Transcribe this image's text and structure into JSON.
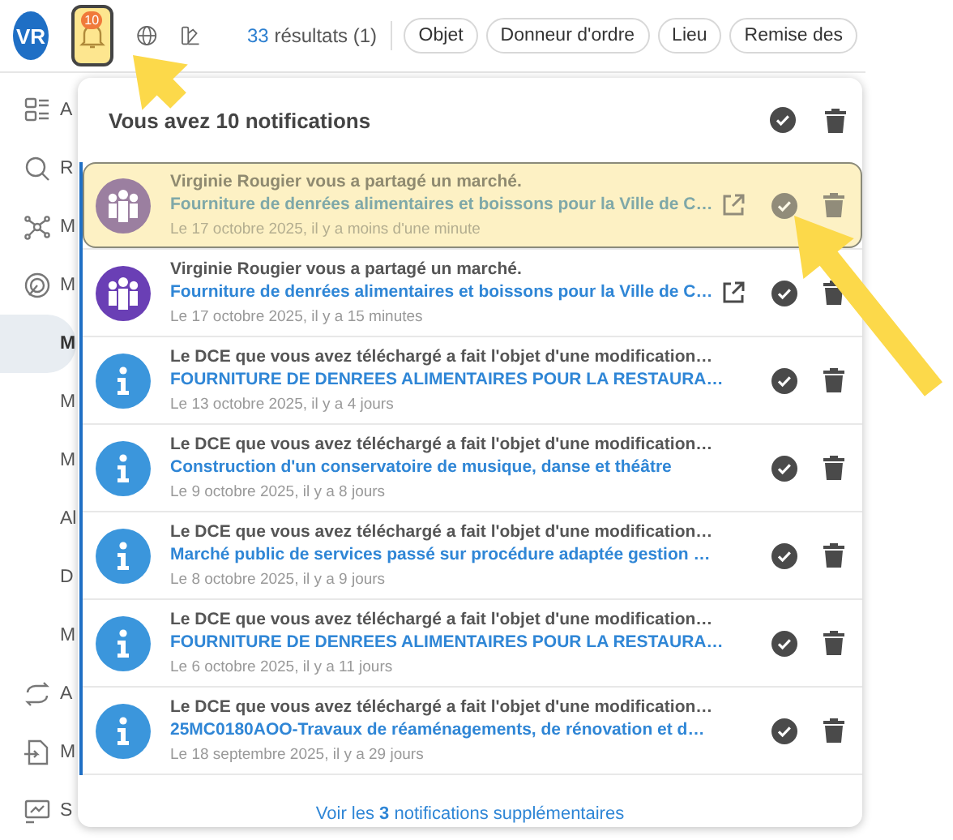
{
  "topbar": {
    "avatar": "VR",
    "bell": {
      "badge": "10",
      "selected": true
    },
    "results_count": "33",
    "results_label": "résultats (1)",
    "filters": [
      "Objet",
      "Donneur d'ordre",
      "Lieu",
      "Remise des"
    ]
  },
  "sidebar": {
    "items": [
      {
        "label": "A",
        "kind": "main",
        "selected": false
      },
      {
        "label": "R",
        "kind": "main",
        "selected": false
      },
      {
        "label": "M",
        "kind": "main",
        "selected": false
      },
      {
        "label": "M",
        "kind": "main",
        "selected": false
      },
      {
        "label": "M",
        "kind": "sub",
        "selected": true
      },
      {
        "label": "M",
        "kind": "sub",
        "selected": false
      },
      {
        "label": "M",
        "kind": "sub",
        "selected": false
      },
      {
        "label": "Al",
        "kind": "sub",
        "selected": false
      },
      {
        "label": "D",
        "kind": "sub",
        "selected": false
      },
      {
        "label": "M",
        "kind": "sub",
        "selected": false
      },
      {
        "label": "A",
        "kind": "main",
        "selected": false
      },
      {
        "label": "M",
        "kind": "main",
        "selected": false
      },
      {
        "label": "S",
        "kind": "main",
        "selected": false
      }
    ]
  },
  "notifications": {
    "title": "Vous avez **10** notifications",
    "items": [
      {
        "kind": "share",
        "highlighted": true,
        "title": "Virginie Rougier vous a partagé un marché.",
        "link": "Fourniture de denrées alimentaires et boissons pour la Ville de C…",
        "date": "Le 17 octobre 2025, il y a moins d'une minute"
      },
      {
        "kind": "share",
        "highlighted": false,
        "title": "Virginie Rougier vous a partagé un marché.",
        "link": "Fourniture de denrées alimentaires et boissons pour la Ville de C…",
        "date": "Le 17 octobre 2025, il y a 15 minutes"
      },
      {
        "kind": "update",
        "highlighted": false,
        "title": "Le DCE que vous avez téléchargé a fait l'objet d'une modification…",
        "link": "FOURNITURE DE DENREES ALIMENTAIRES POUR LA RESTAURA…",
        "date": "Le 13 octobre 2025, il y a 4 jours"
      },
      {
        "kind": "update",
        "highlighted": false,
        "title": "Le DCE que vous avez téléchargé a fait l'objet d'une modification…",
        "link": "Construction d'un conservatoire de musique, danse et théâtre",
        "date": "Le 9 octobre 2025, il y a 8 jours"
      },
      {
        "kind": "update",
        "highlighted": false,
        "title": "Le DCE que vous avez téléchargé a fait l'objet d'une modification…",
        "link": "Marché public de services passé sur procédure adaptée gestion …",
        "date": "Le 8 octobre 2025, il y a 9 jours"
      },
      {
        "kind": "update",
        "highlighted": false,
        "title": "Le DCE que vous avez téléchargé a fait l'objet d'une modification…",
        "link": "FOURNITURE DE DENREES ALIMENTAIRES POUR LA RESTAURA…",
        "date": "Le 6 octobre 2025, il y a 11 jours"
      },
      {
        "kind": "update",
        "highlighted": false,
        "title": "Le DCE que vous avez téléchargé a fait l'objet d'une modification…",
        "link": "25MC0180AOO-Travaux de réaménagements, de rénovation et d…",
        "date": "Le 18 septembre 2025, il y a 29 jours"
      }
    ],
    "more": "Voir les **3** notifications supplémentaires"
  }
}
